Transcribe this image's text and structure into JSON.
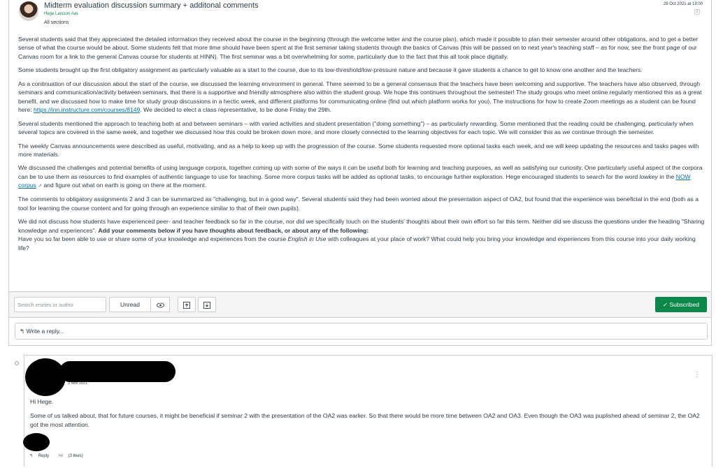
{
  "topic": {
    "title": "Midterm evaluation discussion summary + additonal comments",
    "author": "Hege Larsson Aas",
    "sections": "All sections",
    "date": "28 Oct 2021 at 19:00",
    "unread_count": "1",
    "paragraphs": {
      "p1": "Several students said that they appreciated the detailed information they received about the course in the beginning (through the welcome letter and the course plan), which made it possible to plan their semester around other obligations, and to get a better sense of what the course would be about. Some students felt that more time should have been spent at the first seminar taking students through the basics of Canvas (this will be passed on to next year's teaching staff – as for now, see the front page of our Canvas room for a link to the general Canvas course for students at HINN). The first seminar was a bit overwhelming for some, particularly due to the fact that this all took place digitally.",
      "p2": "Some students brought up the first obligatory assignment as particularly valuable as a start to the course, due to its low-threshold/low-pressure nature and because it gave students a chance to get to know one another and the teachers.",
      "p3_pre": "As a continuation of our discussion about the start of the course, we discussed the learning environment in general. There seemed to be a general consensus that the teachers have been welcoming and supportive. The teachers have also observed, through seminars and communication/activity between seminars, that there is a supportive and friendly atmosphere also within the student group. We hope this continues throughout the semester! The study groups who meet online regularly mentioned this as a great benefit, and we discussed how to make time for study group discussions in a hectic week, and different platforms for communicating online (find out which platform works for you). The instructions for how to create Zoom meetings as a student can be found here: ",
      "p3_link": "https://inn.instructure.com/courses/8149",
      "p3_post": ". We decided to elect a class representative, to be done Friday the 29th.",
      "p4": "Several students mentioned the approach to teaching both at and between seminars – with varied activities and student presentation (\"doing something\") – as particularly rewarding. Some mentioned that the reading could be challenging, particularly when several topics are covered in the same week, and together we discussed how this could be broken down more, and more closely connected to the learning objectives for each topic. We will consider this as we continue through the semester.",
      "p5": "The weekly Canvas announcements were described as useful, motivating, and as a help to keep up with the progression of the course. Some students requested more optional tasks each week, and we will keep updating the resources and tasks pages with more materials.",
      "p6_pre": "We discussed the challenges and potential benefits of using language corpora, together coming up with some of the ways it can be useful both for learning and teaching purposes, as well as satisfying our curiosity. One particularly useful aspect of the corpora can be to use them as resources to find examples of authentic language to use for teaching. Some more corpus tasks will be added as optional tasks, to encourage further exploration. Hege encouraged students to search for the word ",
      "p6_word": "lowkey",
      "p6_mid": " in the ",
      "p6_link": "NOW corpus",
      "p6_post": " and figure out what on earth is going on there at the moment.",
      "p7": "The comments to obligatory assignments 2 and 3 can be summarized as \"challenging, but in a good way\". Several students said they had been worried about the presentation aspect of OA2, but found that the experience was beneficial in the end (both as a tool for learning the course content and for going through an experience similar to that of their own pupils).",
      "p8_pre": "We did not discuss how students have experienced peer- and teacher feedback so far in the course, nor did we specifically touch on the students' thoughts about their own effort so far this term. Neither did we discuss the questions under the heading \"Sharing knowledge and experiences\". ",
      "p8_bold": "Add your comments below if you have thoughts about feedback, or about any of the following:",
      "p8_q_pre": "Have you so far been able to use or share some of your knowledge and experiences from the course ",
      "p8_q_em": "English in Use",
      "p8_q_post": " with colleagues at your place of work? What could help you bring your knowledge and experiences from this course into your daily working life?"
    }
  },
  "toolbar": {
    "search_placeholder": "Search entries or author",
    "unread_label": "Unread",
    "subscribed_label": "Subscribed"
  },
  "reply_box": {
    "label": "Write a reply..."
  },
  "entry": {
    "date": "3 Nov 2021",
    "greeting": "Hi Hege.",
    "text": "Some of us talked about,  that for future courses, it might be beneficial if seminar 2 with the presentation of the OA2 was earlier. So that there would be more time between OA2 and OA3. Even though the OA3 was puplished ahead of seminar 2, the OA2 got the most attention.",
    "reply_label": "Reply",
    "likes_label": "(3 likes)"
  },
  "colors": {
    "accent_green": "#0b874b",
    "link_blue": "#0770a3",
    "border": "#c7cdd1"
  }
}
